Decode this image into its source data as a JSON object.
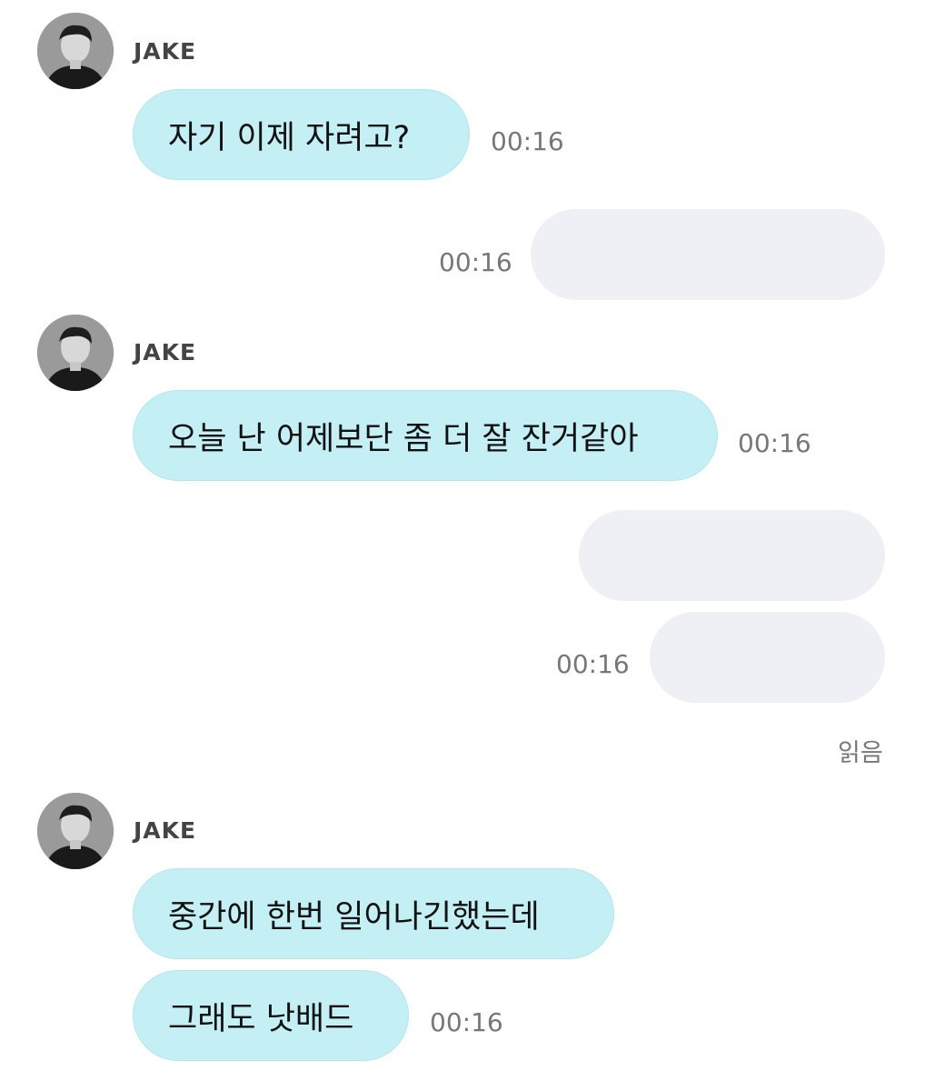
{
  "sender_name": "JAKE",
  "read_label": "읽음",
  "messages": {
    "m1": {
      "text": "자기 이제 자려고?",
      "time": "00:16"
    },
    "m2": {
      "text": "",
      "time": "00:16"
    },
    "m3": {
      "text": "오늘 난 어제보단 좀 더 잘 잔거같아",
      "time": "00:16"
    },
    "m4": {
      "text": ""
    },
    "m5": {
      "text": "",
      "time": "00:16"
    },
    "m6": {
      "text": "중간에 한번 일어나긴했는데"
    },
    "m7": {
      "text": "그래도 낫배드",
      "time": "00:16"
    }
  },
  "colors": {
    "incoming_bubble": "#c4f0f5",
    "outgoing_bubble": "#eff0f5",
    "timestamp": "#777777"
  }
}
